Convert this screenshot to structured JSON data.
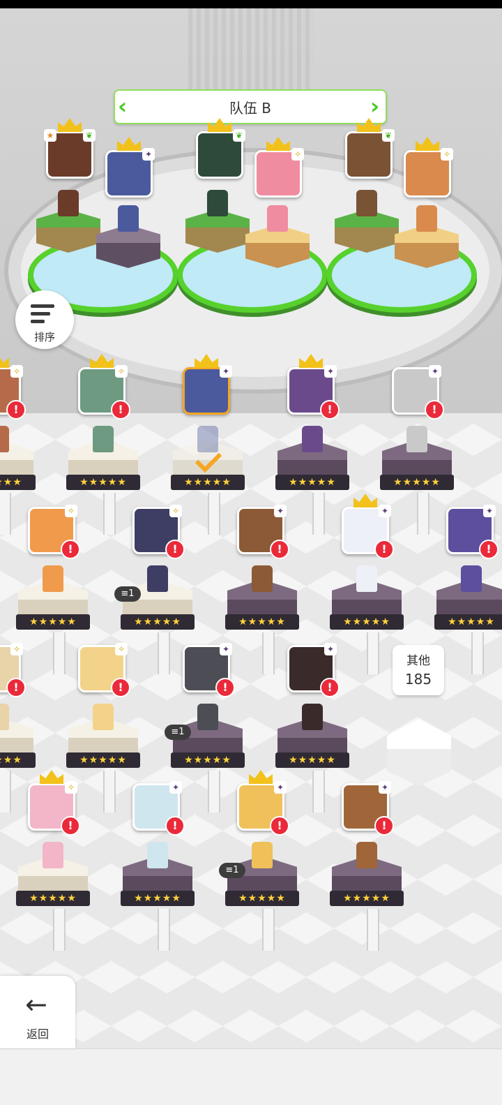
{
  "team": {
    "title": "队伍 B",
    "slots": [
      {
        "crown": true,
        "badge": "leaf",
        "star": true,
        "color": "#6b3b2a"
      },
      {
        "crown": true,
        "badge": "dark",
        "color": "#4a5a9c"
      },
      {
        "crown": true,
        "badge": "leaf",
        "color": "#2e4a3a"
      },
      {
        "crown": true,
        "badge": "light",
        "color": "#f08ca0"
      },
      {
        "crown": true,
        "badge": "leaf",
        "color": "#7a5234"
      },
      {
        "crown": true,
        "badge": "light",
        "color": "#d98a4c"
      }
    ]
  },
  "sort_button": {
    "label": "排序"
  },
  "roster": [
    {
      "color": "#b56b4a",
      "badge": "light",
      "crown": true,
      "alert": "!",
      "pedestal": "light"
    },
    {
      "color": "#6d9a80",
      "badge": "light",
      "crown": true,
      "alert": "!",
      "pedestal": "light"
    },
    {
      "color": "#4a5a9c",
      "badge": "dark",
      "crown": true,
      "selected": true,
      "pedestal": "ghost"
    },
    {
      "color": "#6b4a8c",
      "badge": "dark",
      "crown": true,
      "alert": "!",
      "pedestal": "dark"
    },
    {
      "color": "#c9c9c9",
      "badge": "dark",
      "crown": false,
      "alert": "!",
      "pedestal": "dark"
    },
    {
      "color": "#f09a4c",
      "badge": "light",
      "crown": false,
      "alert": "!",
      "pedestal": "light"
    },
    {
      "color": "#3e3d63",
      "badge": "light",
      "crown": false,
      "alert": "!",
      "pedestal": "light",
      "stack": "1"
    },
    {
      "color": "#8c5a36",
      "badge": "dark",
      "crown": false,
      "alert": "!",
      "pedestal": "dark"
    },
    {
      "color": "#eef0f7",
      "badge": "dark",
      "crown": true,
      "alert": "!",
      "pedestal": "dark"
    },
    {
      "color": "#5d4e9e",
      "badge": "dark",
      "crown": false,
      "alert": "!",
      "pedestal": "dark"
    },
    {
      "color": "#e9d3a8",
      "badge": "light",
      "crown": false,
      "alert": "!",
      "pedestal": "light"
    },
    {
      "color": "#f3d38a",
      "badge": "light",
      "crown": false,
      "alert": "!",
      "pedestal": "light"
    },
    {
      "color": "#4d4d55",
      "badge": "dark",
      "crown": false,
      "alert": "!",
      "pedestal": "dark",
      "stack": "1"
    },
    {
      "color": "#3a2a2a",
      "badge": "dark",
      "crown": false,
      "alert": "!",
      "pedestal": "dark"
    },
    {
      "color": "#f2b6c8",
      "badge": "light",
      "crown": true,
      "alert": "!",
      "pedestal": "light"
    },
    {
      "color": "#cfe6ef",
      "badge": "dark",
      "crown": false,
      "alert": "!",
      "pedestal": "dark"
    },
    {
      "color": "#f0c05a",
      "badge": "dark",
      "crown": true,
      "alert": "!",
      "pedestal": "dark",
      "stack": "1"
    },
    {
      "color": "#a0663a",
      "badge": "dark",
      "crown": false,
      "alert": "!",
      "pedestal": "dark"
    }
  ],
  "stars_text": "★★★★★",
  "others": {
    "label": "其他",
    "count": "185"
  },
  "back_button": {
    "label": "返回"
  }
}
